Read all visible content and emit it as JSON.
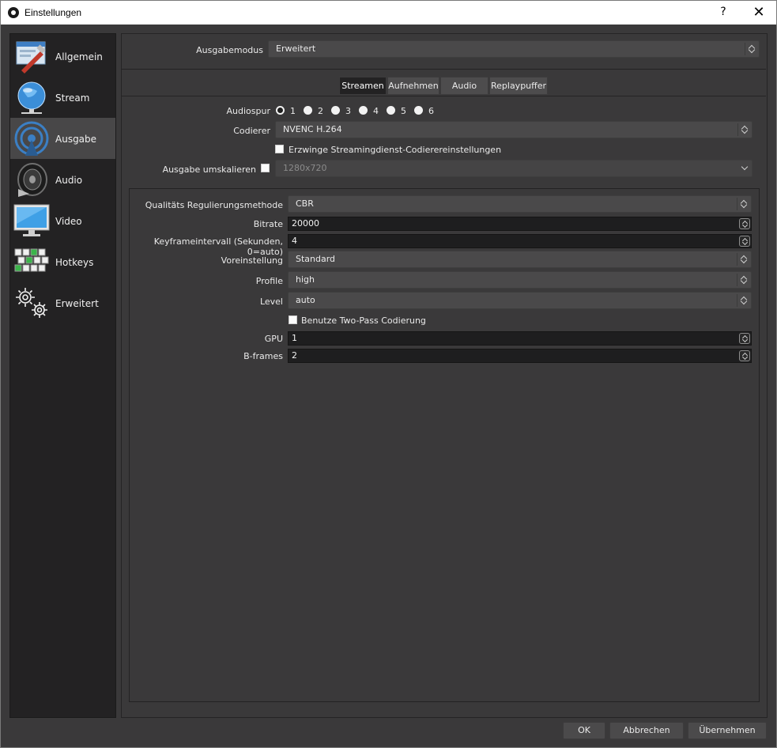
{
  "window": {
    "title": "Einstellungen",
    "help_label": "?",
    "close_label": "✕"
  },
  "sidebar": {
    "items": [
      {
        "label": "Allgemein",
        "icon": "general-settings-icon"
      },
      {
        "label": "Stream",
        "icon": "stream-globe-icon"
      },
      {
        "label": "Ausgabe",
        "icon": "output-broadcast-icon",
        "active": true
      },
      {
        "label": "Audio",
        "icon": "speaker-icon"
      },
      {
        "label": "Video",
        "icon": "monitor-icon"
      },
      {
        "label": "Hotkeys",
        "icon": "keyboard-icon"
      },
      {
        "label": "Erweitert",
        "icon": "gears-icon"
      }
    ]
  },
  "output_mode": {
    "label": "Ausgabemodus",
    "value": "Erweitert"
  },
  "tabs": [
    {
      "label": "Streamen",
      "active": true
    },
    {
      "label": "Aufnehmen"
    },
    {
      "label": "Audio"
    },
    {
      "label": "Replaypuffer"
    }
  ],
  "streaming": {
    "audiotrack": {
      "label": "Audiospur",
      "options": [
        "1",
        "2",
        "3",
        "4",
        "5",
        "6"
      ],
      "selected": "1"
    },
    "encoder": {
      "label": "Codierer",
      "value": "NVENC H.264"
    },
    "enforce_checkbox": {
      "label": "Erzwinge Streamingdienst-Codierereinstellungen",
      "checked": false
    },
    "rescale": {
      "label": "Ausgabe umskalieren",
      "checked": false,
      "value": "1280x720"
    }
  },
  "encoder_settings": {
    "rate_control": {
      "label": "Qualitäts Regulierungsmethode",
      "value": "CBR"
    },
    "bitrate": {
      "label": "Bitrate",
      "value": "20000"
    },
    "keyframe": {
      "label": "Keyframeintervall (Sekunden, 0=auto)",
      "value": "4"
    },
    "preset": {
      "label": "Voreinstellung",
      "value": "Standard"
    },
    "profile": {
      "label": "Profile",
      "value": "high"
    },
    "level": {
      "label": "Level",
      "value": "auto"
    },
    "two_pass": {
      "label": "Benutze Two-Pass Codierung",
      "checked": false
    },
    "gpu": {
      "label": "GPU",
      "value": "1"
    },
    "bframes": {
      "label": "B-frames",
      "value": "2"
    }
  },
  "buttons": {
    "ok": "OK",
    "cancel": "Abbrechen",
    "apply": "Übernehmen"
  }
}
